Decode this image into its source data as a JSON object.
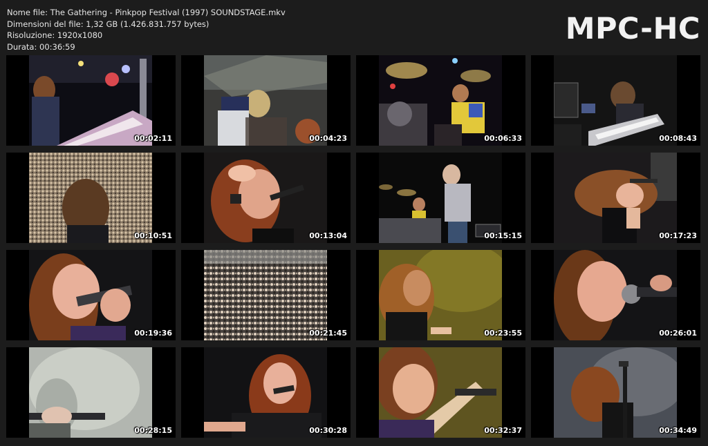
{
  "info": {
    "filename": "Nome file: The Gathering - Pinkpop Festival (1997) SOUNDSTAGE.mkv",
    "filesize": "Dimensioni del file: 1,32 GB (1.426.831.757 bytes)",
    "resolution": "Risoluzione: 1920x1080",
    "duration": "Durata: 00:36:59"
  },
  "logo": "MPC-HC",
  "thumbnails": [
    {
      "time": "00:02:11",
      "scene": "keyboard-stage"
    },
    {
      "time": "00:04:23",
      "scene": "crossfade-singer"
    },
    {
      "time": "00:06:33",
      "scene": "drummer"
    },
    {
      "time": "00:08:43",
      "scene": "keyboardist"
    },
    {
      "time": "00:10:51",
      "scene": "crowd-back"
    },
    {
      "time": "00:13:04",
      "scene": "singer-hand-head"
    },
    {
      "time": "00:15:15",
      "scene": "guitarist-stage"
    },
    {
      "time": "00:17:23",
      "scene": "singer-bent"
    },
    {
      "time": "00:19:36",
      "scene": "singer-closeup"
    },
    {
      "time": "00:21:45",
      "scene": "crowd-front"
    },
    {
      "time": "00:23:55",
      "scene": "singer-yellow"
    },
    {
      "time": "00:26:01",
      "scene": "singer-closeup-2"
    },
    {
      "time": "00:28:15",
      "scene": "singer-haze"
    },
    {
      "time": "00:30:28",
      "scene": "singer-smile"
    },
    {
      "time": "00:32:37",
      "scene": "singer-motion"
    },
    {
      "time": "00:34:49",
      "scene": "singer-smoke"
    }
  ]
}
